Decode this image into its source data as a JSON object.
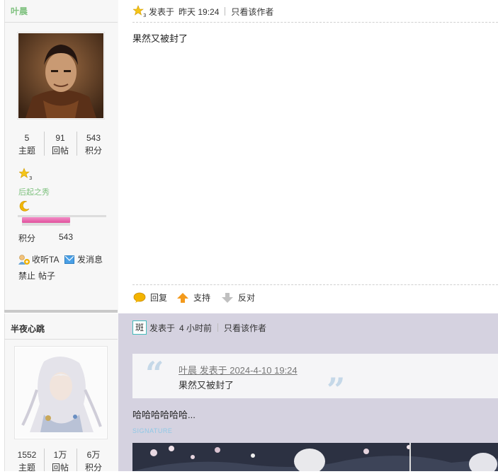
{
  "post1": {
    "author": {
      "name": "叶晨",
      "stats": [
        {
          "value": "5",
          "label": "主题"
        },
        {
          "value": "91",
          "label": "回帖"
        },
        {
          "value": "543",
          "label": "积分"
        }
      ],
      "rank_title": "后起之秀",
      "level_progress": 0.54,
      "points_label": "积分",
      "points_value": "543",
      "actions": {
        "follow": "收听TA",
        "message": "发消息"
      },
      "mod_links": {
        "ban": "禁止",
        "posts": "帖子"
      }
    },
    "meta": {
      "posted": "发表于",
      "time": "昨天 19:24",
      "author_only": "只看该作者"
    },
    "content": "果然又被封了",
    "actions": {
      "reply": "回复",
      "support": "支持",
      "oppose": "反对"
    }
  },
  "post2": {
    "author": {
      "name": "半夜心跳",
      "stats": [
        {
          "value": "1552",
          "label": "主题"
        },
        {
          "value": "1万",
          "label": "回帖"
        },
        {
          "value": "6万",
          "label": "积分"
        }
      ]
    },
    "meta": {
      "badge": "斑",
      "posted": "发表于",
      "time": "4 小时前",
      "author_only": "只看该作者"
    },
    "quote": {
      "header": "叶晨 发表于 2024-4-10 19:24",
      "text": "果然又被封了"
    },
    "content": "哈哈哈哈哈哈...",
    "signature_label": "SIGNATURE"
  },
  "colors": {
    "green": "#7fc17f",
    "pink": "#e0509b",
    "lavender": "#d5d2e0"
  }
}
